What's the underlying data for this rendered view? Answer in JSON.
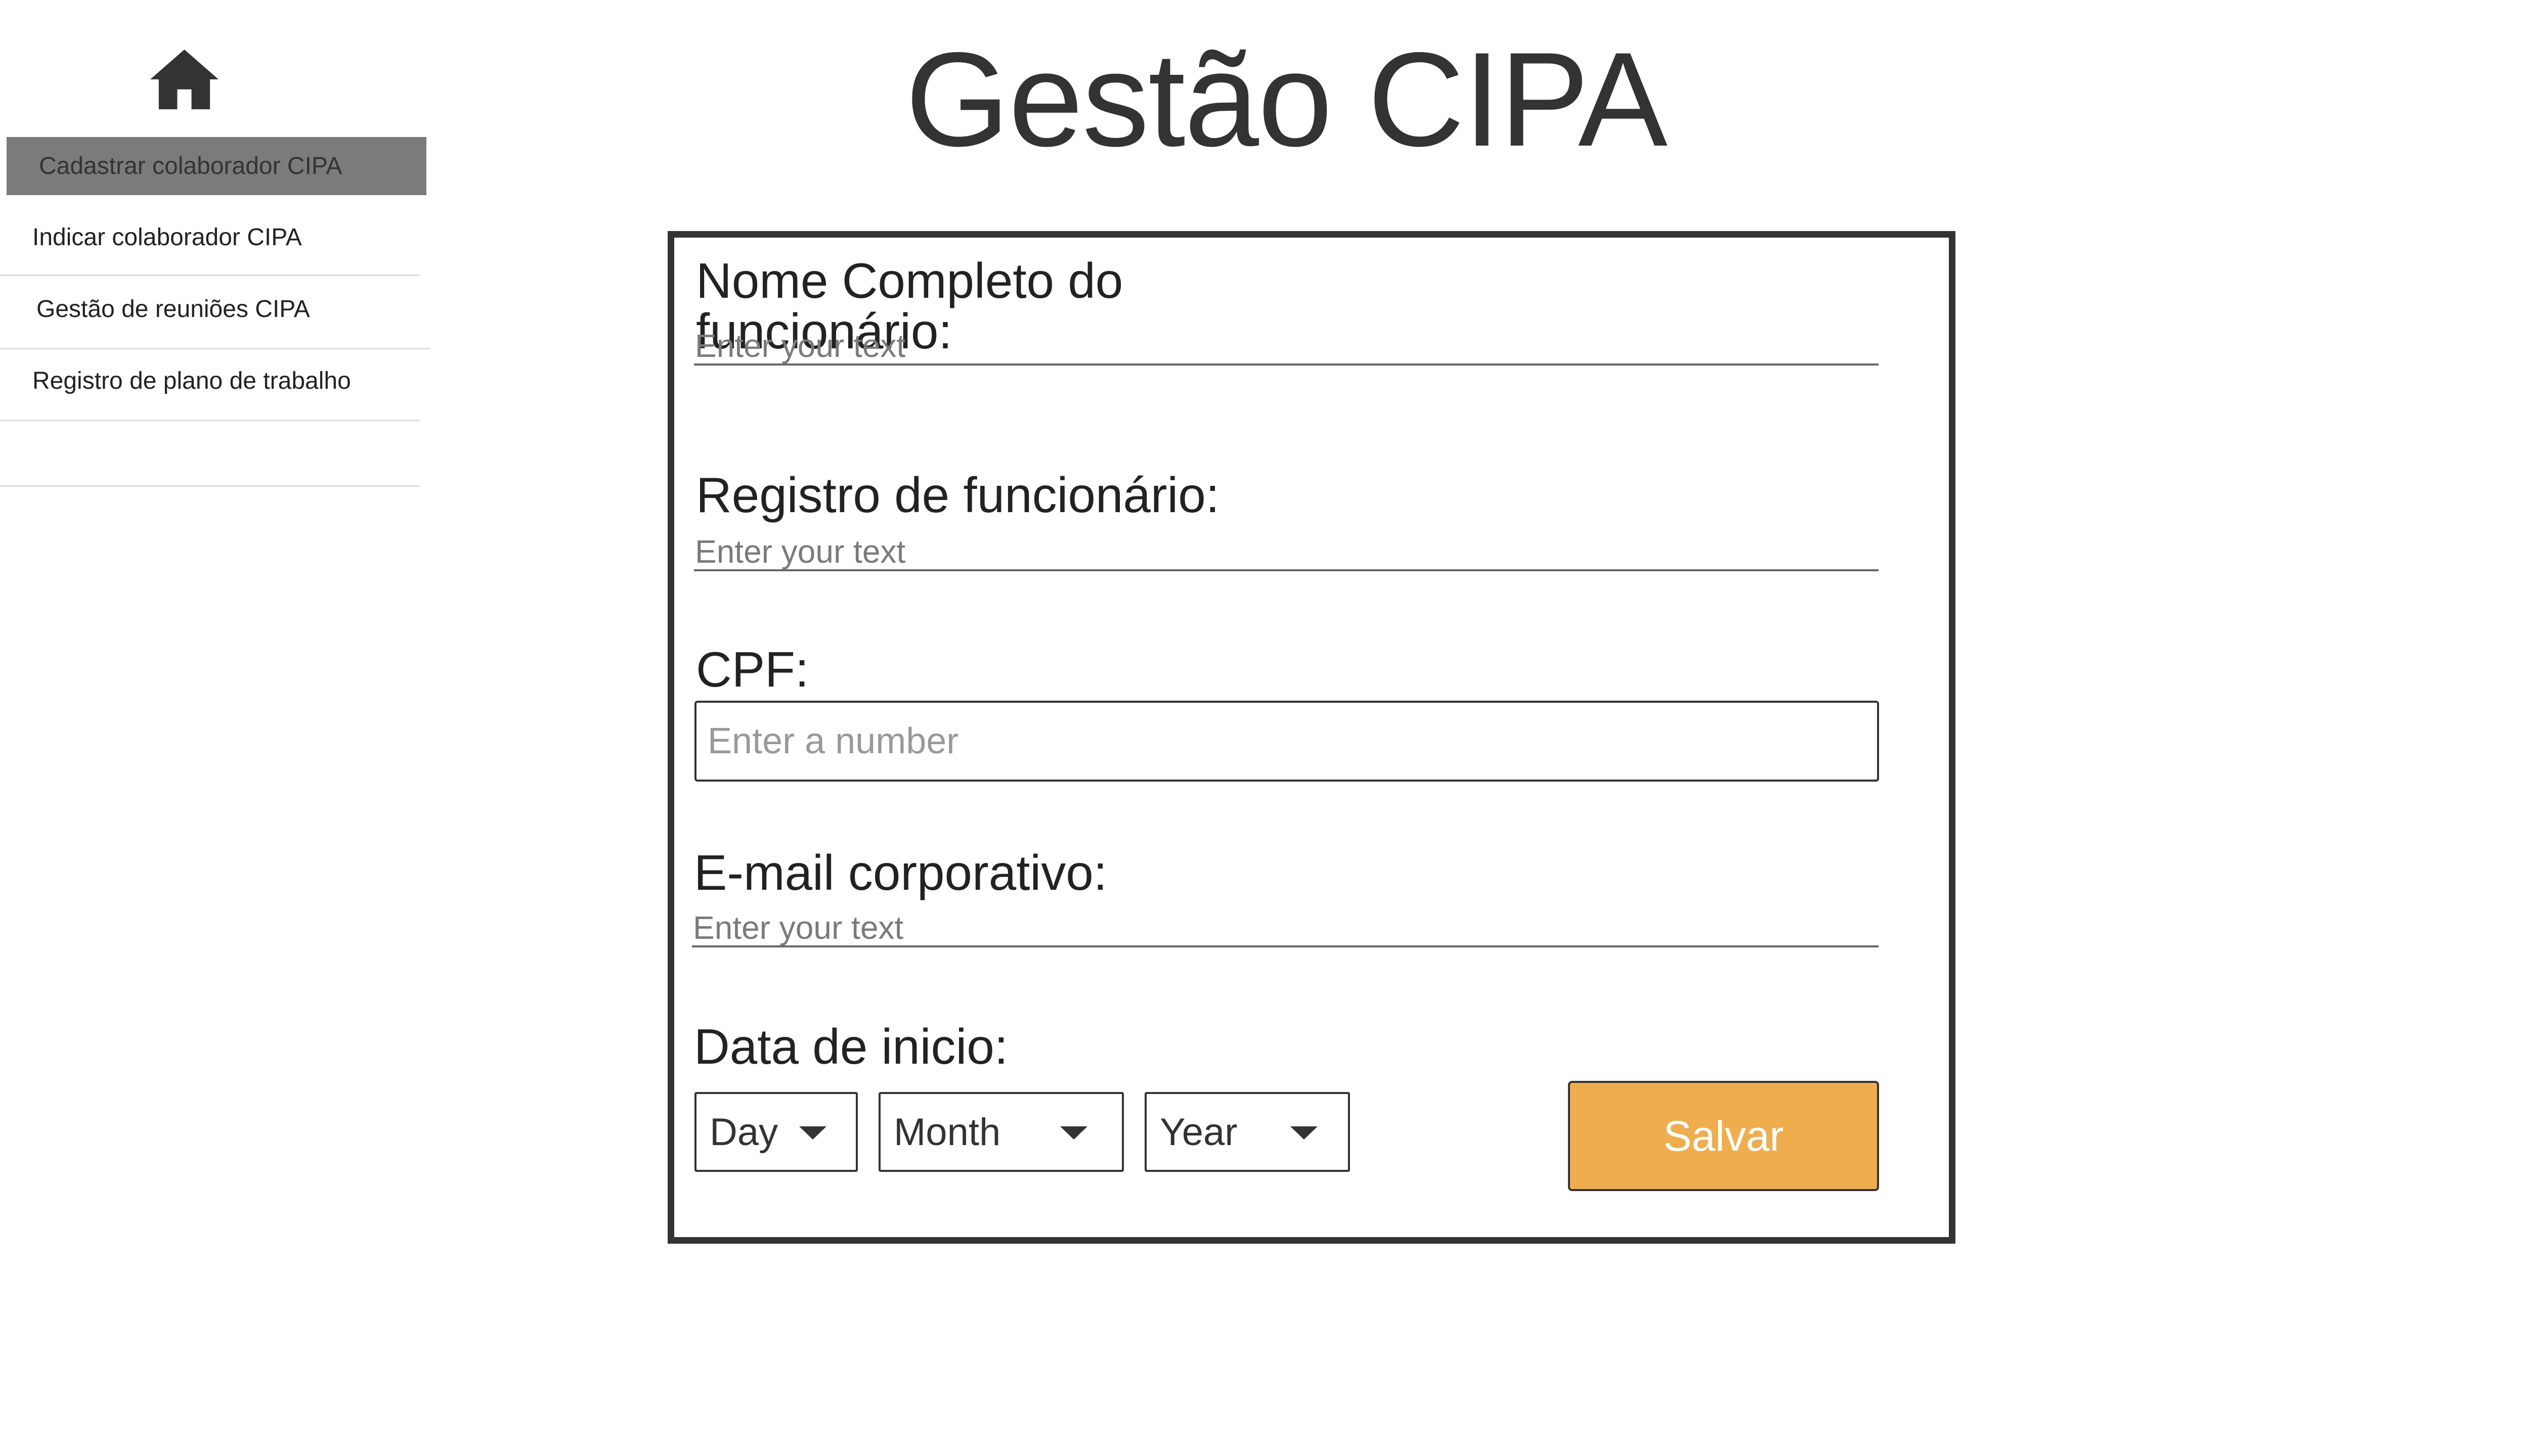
{
  "app": {
    "title": "Gestão CIPA"
  },
  "sidebar": {
    "home_icon": "home-icon",
    "items": [
      {
        "label": "Cadastrar colaborador CIPA",
        "active": true
      },
      {
        "label": "Indicar colaborador CIPA",
        "active": false
      },
      {
        "label": "Gestão de reuniões CIPA",
        "active": false
      },
      {
        "label": "Registro de plano de trabalho",
        "active": false
      }
    ]
  },
  "form": {
    "name": {
      "label": "Nome Completo do funcionário:",
      "placeholder": "Enter your text",
      "value": ""
    },
    "registro": {
      "label": "Registro de funcionário:",
      "placeholder": "Enter your text",
      "value": ""
    },
    "cpf": {
      "label": "CPF:",
      "placeholder": "Enter a number",
      "value": ""
    },
    "email": {
      "label": "E-mail corporativo:",
      "placeholder": "Enter your text",
      "value": ""
    },
    "data_inicio": {
      "label": "Data de inicio:",
      "day": "Day",
      "month": "Month",
      "year": "Year"
    },
    "save_label": "Salvar"
  },
  "colors": {
    "text": "#333333",
    "active_nav_bg": "#7b7b7b",
    "save_button_bg": "#f0ad4e",
    "panel_border": "#333333"
  }
}
